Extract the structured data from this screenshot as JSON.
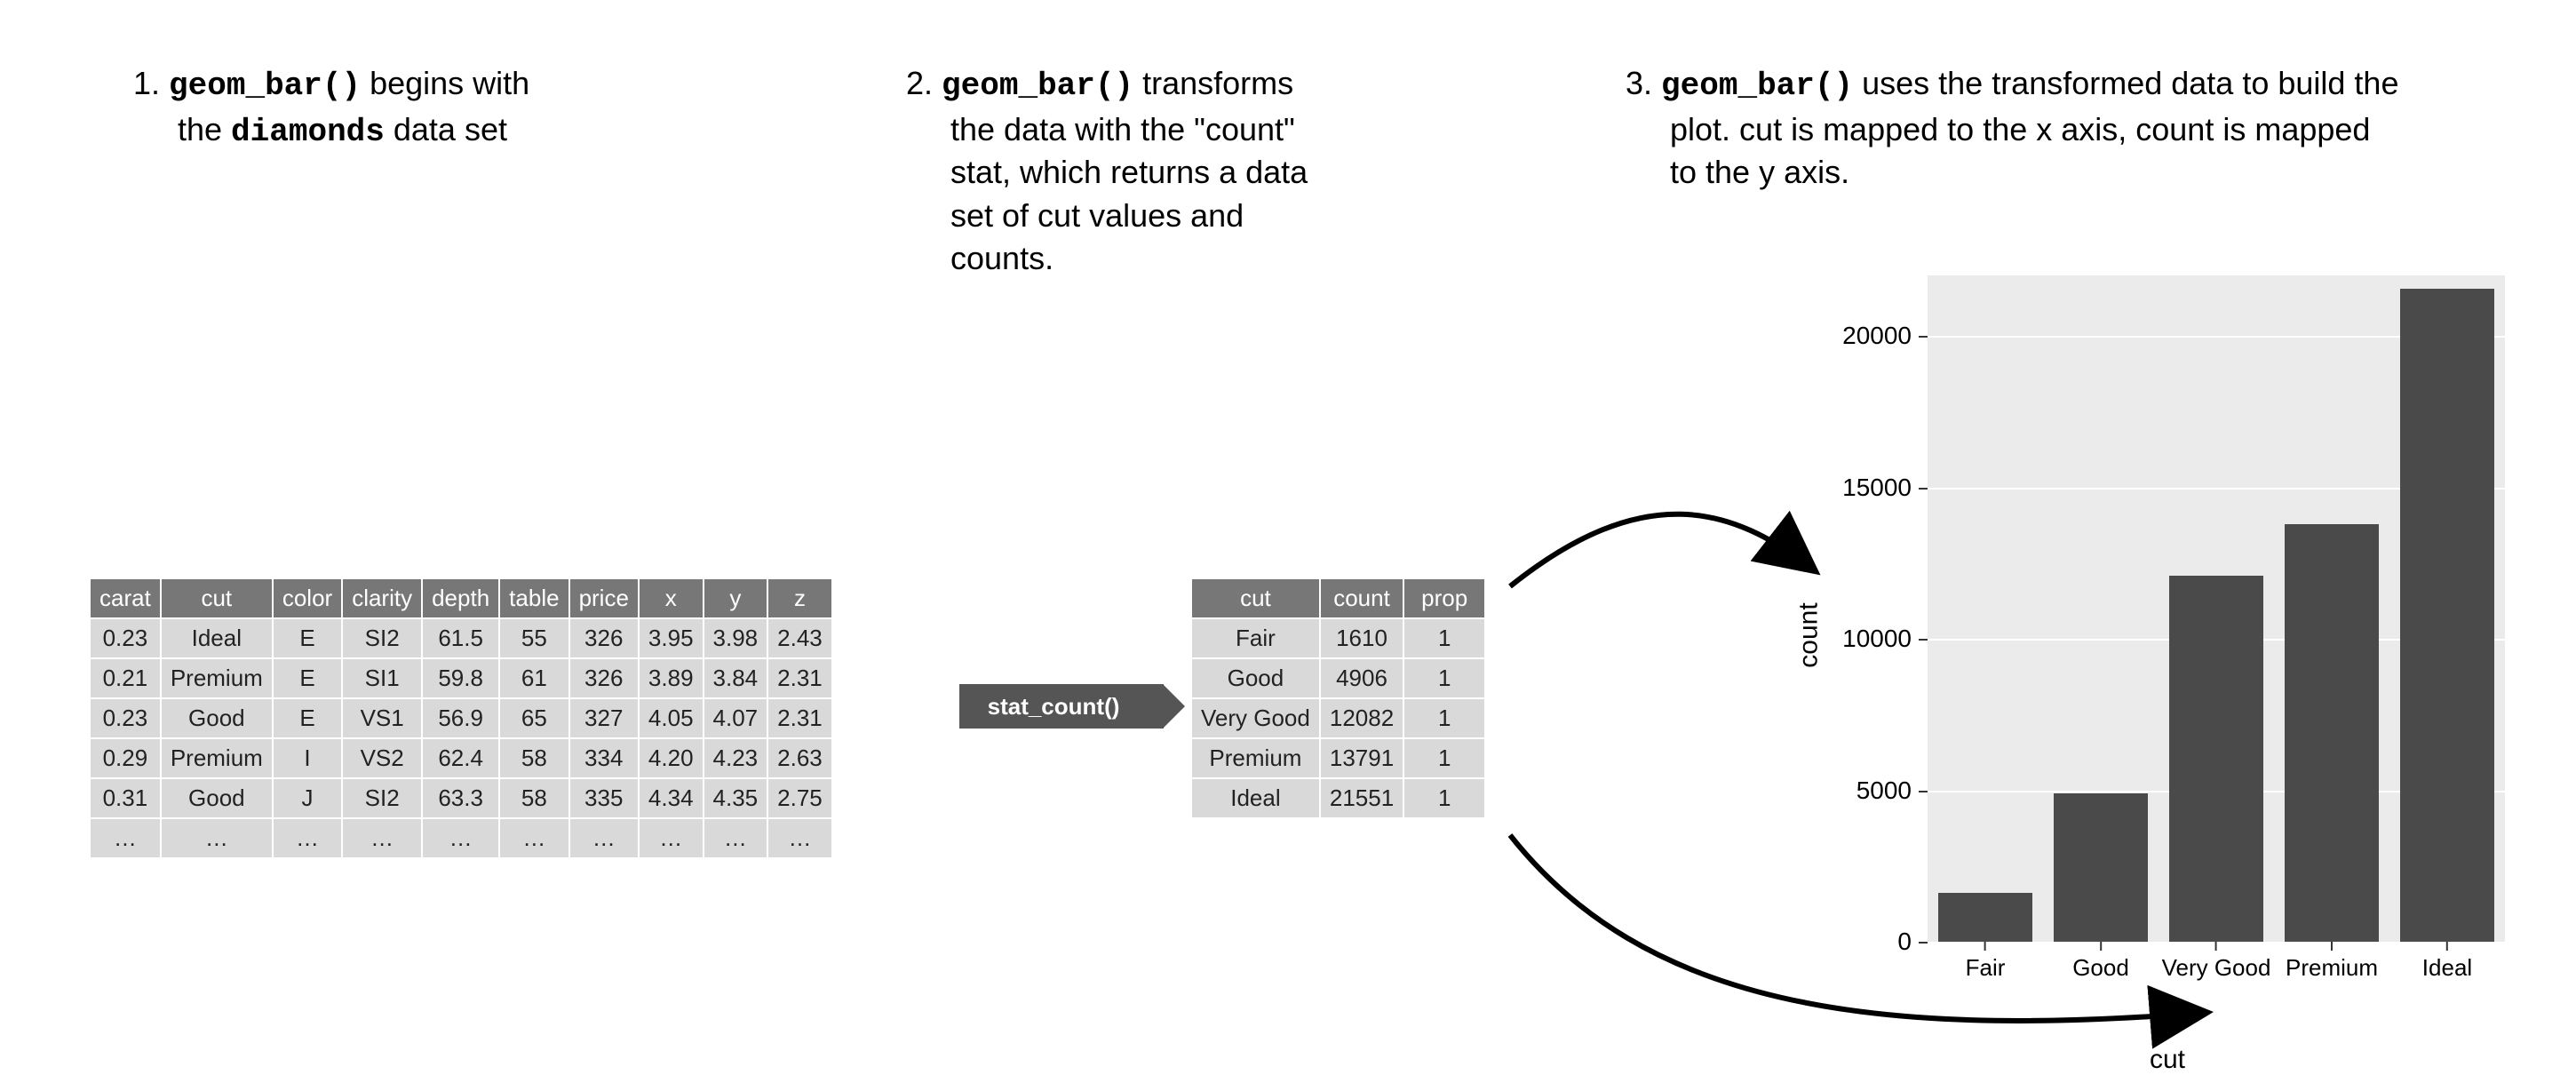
{
  "steps": {
    "s1_num": "1.",
    "s1_code": "geom_bar()",
    "s1_tail": " begins with",
    "s1_line2a": "the ",
    "s1_code2": "diamonds",
    "s1_line2b": " data set",
    "s2_num": "2.",
    "s2_code": "geom_bar()",
    "s2_tail": " transforms",
    "s2_line2": "the data with the \"count\"",
    "s2_line3": "stat, which returns a data",
    "s2_line4": "set of cut values and",
    "s2_line5": "counts.",
    "s3_num": "3.",
    "s3_code": "geom_bar()",
    "s3_tail": " uses the transformed data to build the",
    "s3_line2": "plot. cut is mapped to the x axis, count is mapped",
    "s3_line3": "to the y axis."
  },
  "stat_badge": "stat_count()",
  "diamonds": {
    "headers": [
      "carat",
      "cut",
      "color",
      "clarity",
      "depth",
      "table",
      "price",
      "x",
      "y",
      "z"
    ],
    "rows": [
      [
        "0.23",
        "Ideal",
        "E",
        "SI2",
        "61.5",
        "55",
        "326",
        "3.95",
        "3.98",
        "2.43"
      ],
      [
        "0.21",
        "Premium",
        "E",
        "SI1",
        "59.8",
        "61",
        "326",
        "3.89",
        "3.84",
        "2.31"
      ],
      [
        "0.23",
        "Good",
        "E",
        "VS1",
        "56.9",
        "65",
        "327",
        "4.05",
        "4.07",
        "2.31"
      ],
      [
        "0.29",
        "Premium",
        "I",
        "VS2",
        "62.4",
        "58",
        "334",
        "4.20",
        "4.23",
        "2.63"
      ],
      [
        "0.31",
        "Good",
        "J",
        "SI2",
        "63.3",
        "58",
        "335",
        "4.34",
        "4.35",
        "2.75"
      ],
      [
        "…",
        "…",
        "…",
        "…",
        "…",
        "…",
        "…",
        "…",
        "…",
        "…"
      ]
    ]
  },
  "counts": {
    "headers": [
      "cut",
      "count",
      "prop"
    ],
    "rows": [
      [
        "Fair",
        "1610",
        "1"
      ],
      [
        "Good",
        "4906",
        "1"
      ],
      [
        "Very Good",
        "12082",
        "1"
      ],
      [
        "Premium",
        "13791",
        "1"
      ],
      [
        "Ideal",
        "21551",
        "1"
      ]
    ]
  },
  "chart_data": {
    "type": "bar",
    "categories": [
      "Fair",
      "Good",
      "Very Good",
      "Premium",
      "Ideal"
    ],
    "values": [
      1610,
      4906,
      12082,
      13791,
      21551
    ],
    "title": "",
    "xlabel": "cut",
    "ylabel": "count",
    "ylim": [
      0,
      22000
    ],
    "yticks": [
      0,
      5000,
      10000,
      15000,
      20000
    ],
    "ytick_labels": [
      "0",
      "5000",
      "10000",
      "15000",
      "20000"
    ]
  }
}
